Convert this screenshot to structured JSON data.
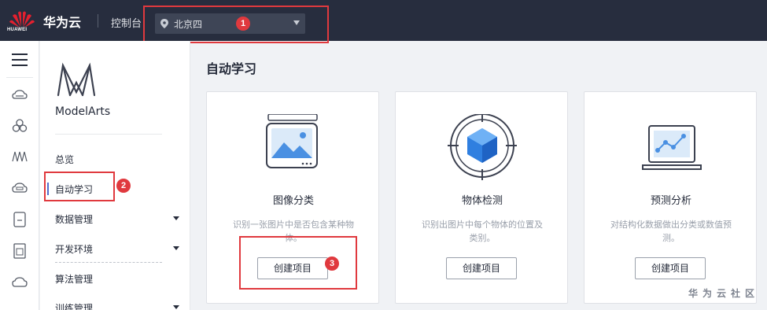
{
  "header": {
    "logo_text": "HUAWEI",
    "brand": "华为云",
    "console": "控制台",
    "region": "北京四"
  },
  "callouts": {
    "one": "1",
    "two": "2",
    "three": "3"
  },
  "sidebar": {
    "service_name": "ModelArts",
    "items": [
      {
        "label": "总览"
      },
      {
        "label": "自动学习"
      },
      {
        "label": "数据管理"
      },
      {
        "label": "开发环境"
      },
      {
        "label": "算法管理"
      },
      {
        "label": "训练管理"
      }
    ]
  },
  "main": {
    "title": "自动学习",
    "cards": [
      {
        "title": "图像分类",
        "desc": "识别一张图片中是否包含某种物体。",
        "button": "创建项目",
        "icon": "image-classification-icon"
      },
      {
        "title": "物体检测",
        "desc": "识别出图片中每个物体的位置及类别。",
        "button": "创建项目",
        "icon": "object-detection-icon"
      },
      {
        "title": "预测分析",
        "desc": "对结构化数据做出分类或数值预测。",
        "button": "创建项目",
        "icon": "predictive-analytics-icon"
      }
    ]
  },
  "watermark": "华为云社区",
  "colors": {
    "topbar": "#272d3e",
    "accent": "#526ecc",
    "callout": "#e0393e"
  }
}
